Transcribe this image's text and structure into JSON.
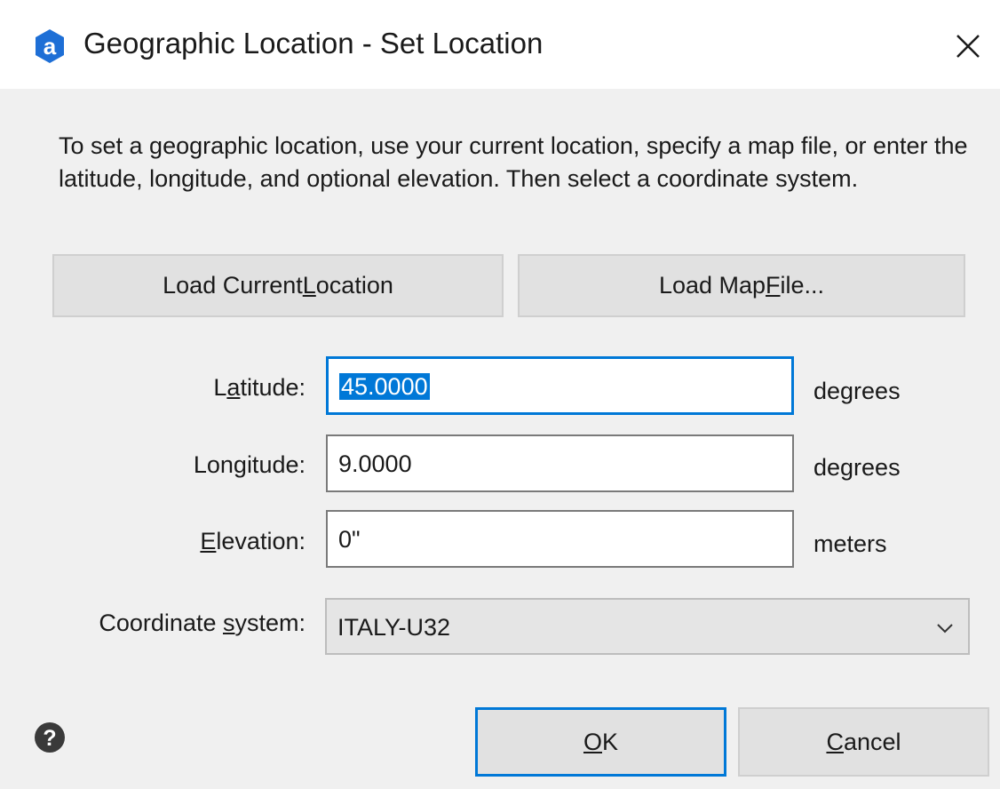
{
  "window": {
    "title": "Geographic Location - Set Location"
  },
  "instructions": "To set a geographic location, use your current location, specify a map file, or enter the latitude, longitude, and optional elevation. Then select a coordinate system.",
  "buttons": {
    "load_current_pre": "Load Current ",
    "load_current_key": "L",
    "load_current_post": "ocation",
    "load_map_pre": "Load Map ",
    "load_map_key": "F",
    "load_map_post": "ile...",
    "ok_key": "O",
    "ok_post": "K",
    "cancel_key": "C",
    "cancel_post": "ancel"
  },
  "fields": {
    "latitude": {
      "label_pre": "L",
      "label_key": "a",
      "label_post": "titude:",
      "value": "45.0000",
      "unit": "degrees"
    },
    "longitude": {
      "label_pre": "Lon",
      "label_key": "g",
      "label_post": "itude:",
      "value": "9.0000",
      "unit": "degrees"
    },
    "elevation": {
      "label_pre": "",
      "label_key": "E",
      "label_post": "levation:",
      "value": "0\"",
      "unit": "meters"
    }
  },
  "coordinate_system": {
    "label_pre": "Coordinate ",
    "label_key": "s",
    "label_post": "ystem:",
    "value": "ITALY-U32"
  },
  "icons": {
    "app": "autocad-a-icon",
    "close": "close-icon",
    "dropdown": "chevron-down-icon",
    "help": "help-icon"
  },
  "colors": {
    "accent": "#0078d7",
    "app_icon": "#1e6fd6",
    "help_icon": "#3a3a3a"
  }
}
